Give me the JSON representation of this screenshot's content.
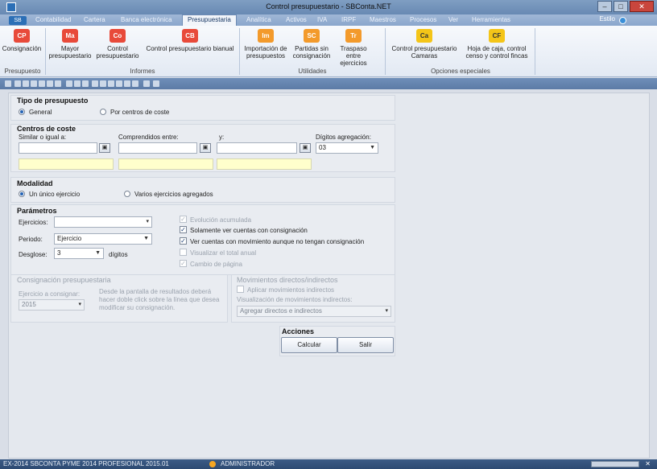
{
  "window": {
    "title": "Control presupuestario - SBConta.NET"
  },
  "menu": {
    "app_button": "SB",
    "tabs": [
      "Contabilidad",
      "Cartera",
      "Banca electrónica",
      "Presupuestaria",
      "Analítica",
      "Activos",
      "IVA",
      "IRPF",
      "Maestros",
      "Procesos",
      "Ver",
      "Herramientas"
    ],
    "active_tab": "Presupuestaria",
    "estilo": "Estilo"
  },
  "ribbon": {
    "buttons": [
      {
        "icon": "CP",
        "label": "Consignación",
        "color": "#e84a3a"
      },
      {
        "icon": "Ma",
        "label": "Mayor presupuestario",
        "color": "#e84a3a"
      },
      {
        "icon": "Co",
        "label": "Control presupuestario",
        "color": "#e84a3a"
      },
      {
        "icon": "CB",
        "label": "Control presupuestario bianual",
        "color": "#e84a3a"
      },
      {
        "icon": "Im",
        "label": "Importación de presupuestos",
        "color": "#f39a2b"
      },
      {
        "icon": "SC",
        "label": "Partidas sin consignación",
        "color": "#f39a2b"
      },
      {
        "icon": "Tr",
        "label": "Traspaso entre ejercicios",
        "color": "#f39a2b"
      },
      {
        "icon": "Ca",
        "label": "Control presupuestario Camaras",
        "color": "#f4c518"
      },
      {
        "icon": "CF",
        "label": "Hoja de caja, control censo y control fincas",
        "color": "#f4c518"
      }
    ],
    "groups": [
      "Presupuesto",
      "Informes",
      "Utilidades",
      "Opciones especiales"
    ]
  },
  "form": {
    "tipo": {
      "title": "Tipo de presupuesto",
      "options": [
        "General",
        "Por centros de coste"
      ],
      "selected": "General"
    },
    "centros": {
      "title": "Centros de coste",
      "similar_label": "Similar o igual a:",
      "comprendidos_label": "Comprendidos entre:",
      "y_label": "y:",
      "digitos_label": "Dígitos agregación:",
      "digitos_value": "03"
    },
    "modalidad": {
      "title": "Modalidad",
      "options": [
        "Un único ejercicio",
        "Varios ejercicios agregados"
      ],
      "selected": "Un único ejercicio"
    },
    "parametros": {
      "title": "Parámetros",
      "ejercicios_label": "Ejercicios:",
      "ejercicios_value": "",
      "periodo_label": "Periodo:",
      "periodo_value": "Ejercicio",
      "desglose_label": "Desglose:",
      "desglose_value": "3",
      "digitos_suffix": "dígitos",
      "checks": [
        {
          "label": "Evolución acumulada",
          "checked": true,
          "enabled": false
        },
        {
          "label": "Solamente ver cuentas con consignación",
          "checked": true,
          "enabled": true
        },
        {
          "label": "Ver cuentas con movimiento aunque no tengan consignación",
          "checked": true,
          "enabled": true
        },
        {
          "label": "Visualizar el total anual",
          "checked": false,
          "enabled": false
        },
        {
          "label": "Cambio de página",
          "checked": true,
          "enabled": false
        }
      ]
    },
    "consignacion": {
      "title": "Consignación presupuestaria",
      "ejercicio_label": "Ejercicio a consignar:",
      "ejercicio_value": "2015",
      "note": "Desde la pantalla de resultados deberá hacer doble click sobre la línea que desea modificar su consignación."
    },
    "movimientos": {
      "title": "Movimientos directos/indirectos",
      "aplicar_label": "Aplicar movimientos indirectos",
      "visualizacion_label": "Visualización de movimientos indirectos:",
      "visualizacion_value": "Agregar directos e indirectos"
    },
    "acciones": {
      "title": "Acciones",
      "calcular": "Calcular",
      "salir": "Salir"
    }
  },
  "status": {
    "left": "EX-2014  SBCONTA PYME 2014  PROFESIONAL 2015.01",
    "user": "ADMINISTRADOR"
  }
}
